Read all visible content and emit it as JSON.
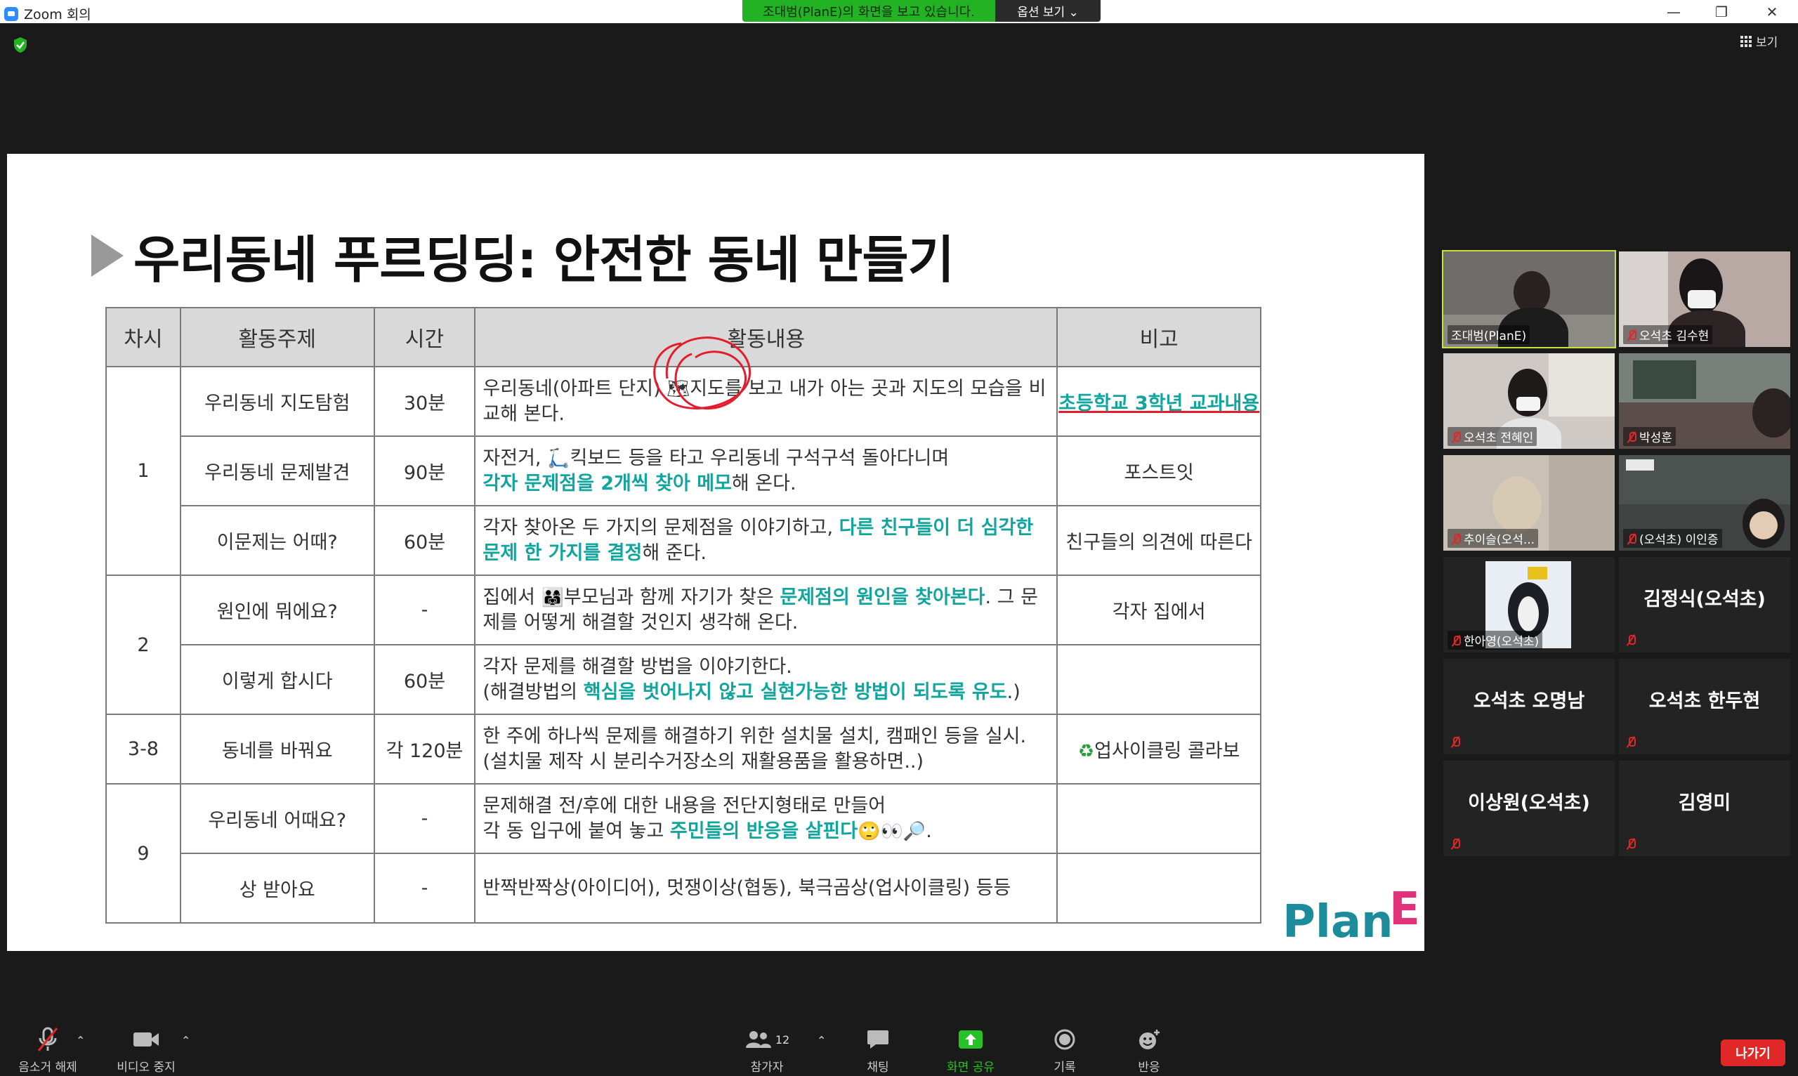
{
  "window": {
    "app_title": "Zoom 회의",
    "share_banner": "조대범(PlanE)의 화면을 보고 있습니다.",
    "view_options": "옵션 보기 ⌄",
    "view_button": "보기"
  },
  "slide": {
    "title": "우리동네 푸르딩딩: 안전한 동네 만들기",
    "headers": [
      "차시",
      "활동주제",
      "시간",
      "활동내용",
      "비고"
    ],
    "sessions": [
      "1",
      "2",
      "3-8",
      "9"
    ],
    "rows": [
      {
        "topic": "우리동네 지도탐험",
        "time": "30분",
        "content_a": "우리동네(아파트 단지) ",
        "content_emoji": "🗺",
        "content_b": "지도를 보고 내가 아는 곳과 지도의 모습을 비교해 본다.",
        "note": "초등학교 3학년 교과내용"
      },
      {
        "topic": "우리동네 문제발견",
        "time": "90분",
        "content_a": "자전거, ",
        "content_emoji": "🛴",
        "content_b": "킥보드 등을 타고 우리동네 구석구석 돌아다니며",
        "content_hl": "각자 문제점을 2개씩 찾아 메모",
        "content_c": "해 온다.",
        "note": "포스트잇"
      },
      {
        "topic": "이문제는 어때?",
        "time": "60분",
        "content_a": "각자 찾아온 두 가지의 문제점을 이야기하고, ",
        "content_hl": "다른 친구들이 더 심각한 문제 한 가지를 결정",
        "content_c": "해 준다.",
        "note": "친구들의 의견에 따른다"
      },
      {
        "topic": "원인에 뭐에요?",
        "time": "-",
        "content_a": "집에서 ",
        "content_emoji": "👨‍👩‍👧",
        "content_b": "부모님과 함께 자기가 찾은 ",
        "content_hl": "문제점의 원인을 찾아본다",
        "content_c": ". 그 문제를 어떻게 해결할 것인지 생각해 온다.",
        "note": "각자 집에서"
      },
      {
        "topic": "이렇게 합시다",
        "time": "60분",
        "content_a": "각자 문제를 해결할 방법을 이야기한다.",
        "content_b": "(해결방법의 ",
        "content_hl": "핵심을 벗어나지 않고 실현가능한 방법이 되도록 유도",
        "content_c": ".)",
        "note": ""
      },
      {
        "topic": "동네를 바꿔요",
        "time": "각 120분",
        "content_a": "한 주에 하나씩 문제를 해결하기 위한 설치물 설치, 캠패인 등을 실시.",
        "content_b": "(설치물 제작 시 분리수거장소의 재활용품을 활용하면..)",
        "note_emoji": "♻",
        "note": "업사이클링 콜라보"
      },
      {
        "topic": "우리동네 어때요?",
        "time": "-",
        "content_a": "문제해결 전/후에 대한 내용을 전단지형태로 만들어",
        "content_b": "각 동 입구에 붙여 놓고 ",
        "content_hl": "주민들의 반응을 살핀다",
        "content_emoji": "🙄👀🔎",
        "content_c": ".",
        "note": ""
      },
      {
        "topic": "상 받아요",
        "time": "-",
        "content_a": "반짝반짝상(아이디어), 멋쟁이상(협동), 북극곰상(업사이클링) 등등",
        "note": ""
      }
    ],
    "logo": "PlanE"
  },
  "participants": [
    {
      "name": "조대범(PlanE)",
      "video": true,
      "muted": false
    },
    {
      "name": "오석초 김수현",
      "video": true,
      "muted": true
    },
    {
      "name": "오석초 전혜인",
      "video": true,
      "muted": true
    },
    {
      "name": "박성훈",
      "video": true,
      "muted": true
    },
    {
      "name": "추이슬(오석...",
      "video": true,
      "muted": true
    },
    {
      "name": "(오석초) 이인증",
      "video": true,
      "muted": true
    },
    {
      "name": "한아영(오석초)",
      "video": true,
      "muted": true
    },
    {
      "name": "김정식(오석초)",
      "video": false,
      "muted": true
    },
    {
      "name": "오석초 오명남",
      "video": false,
      "muted": true
    },
    {
      "name": "오석초 한두현",
      "video": false,
      "muted": true
    },
    {
      "name": "이상원(오석초)",
      "video": false,
      "muted": true
    },
    {
      "name": "김영미",
      "video": false,
      "muted": true
    }
  ],
  "toolbar": {
    "unmute": "음소거 해제",
    "stop_video": "비디오 중지",
    "participants": "참가자",
    "participant_count": "12",
    "chat": "채팅",
    "share_screen": "화면 공유",
    "record": "기록",
    "reactions": "반응",
    "leave": "나가기"
  },
  "colors": {
    "highlight": "#12a59d",
    "share_green": "#23b223",
    "active_speaker": "#c8e23a",
    "leave_red": "#e02828"
  }
}
